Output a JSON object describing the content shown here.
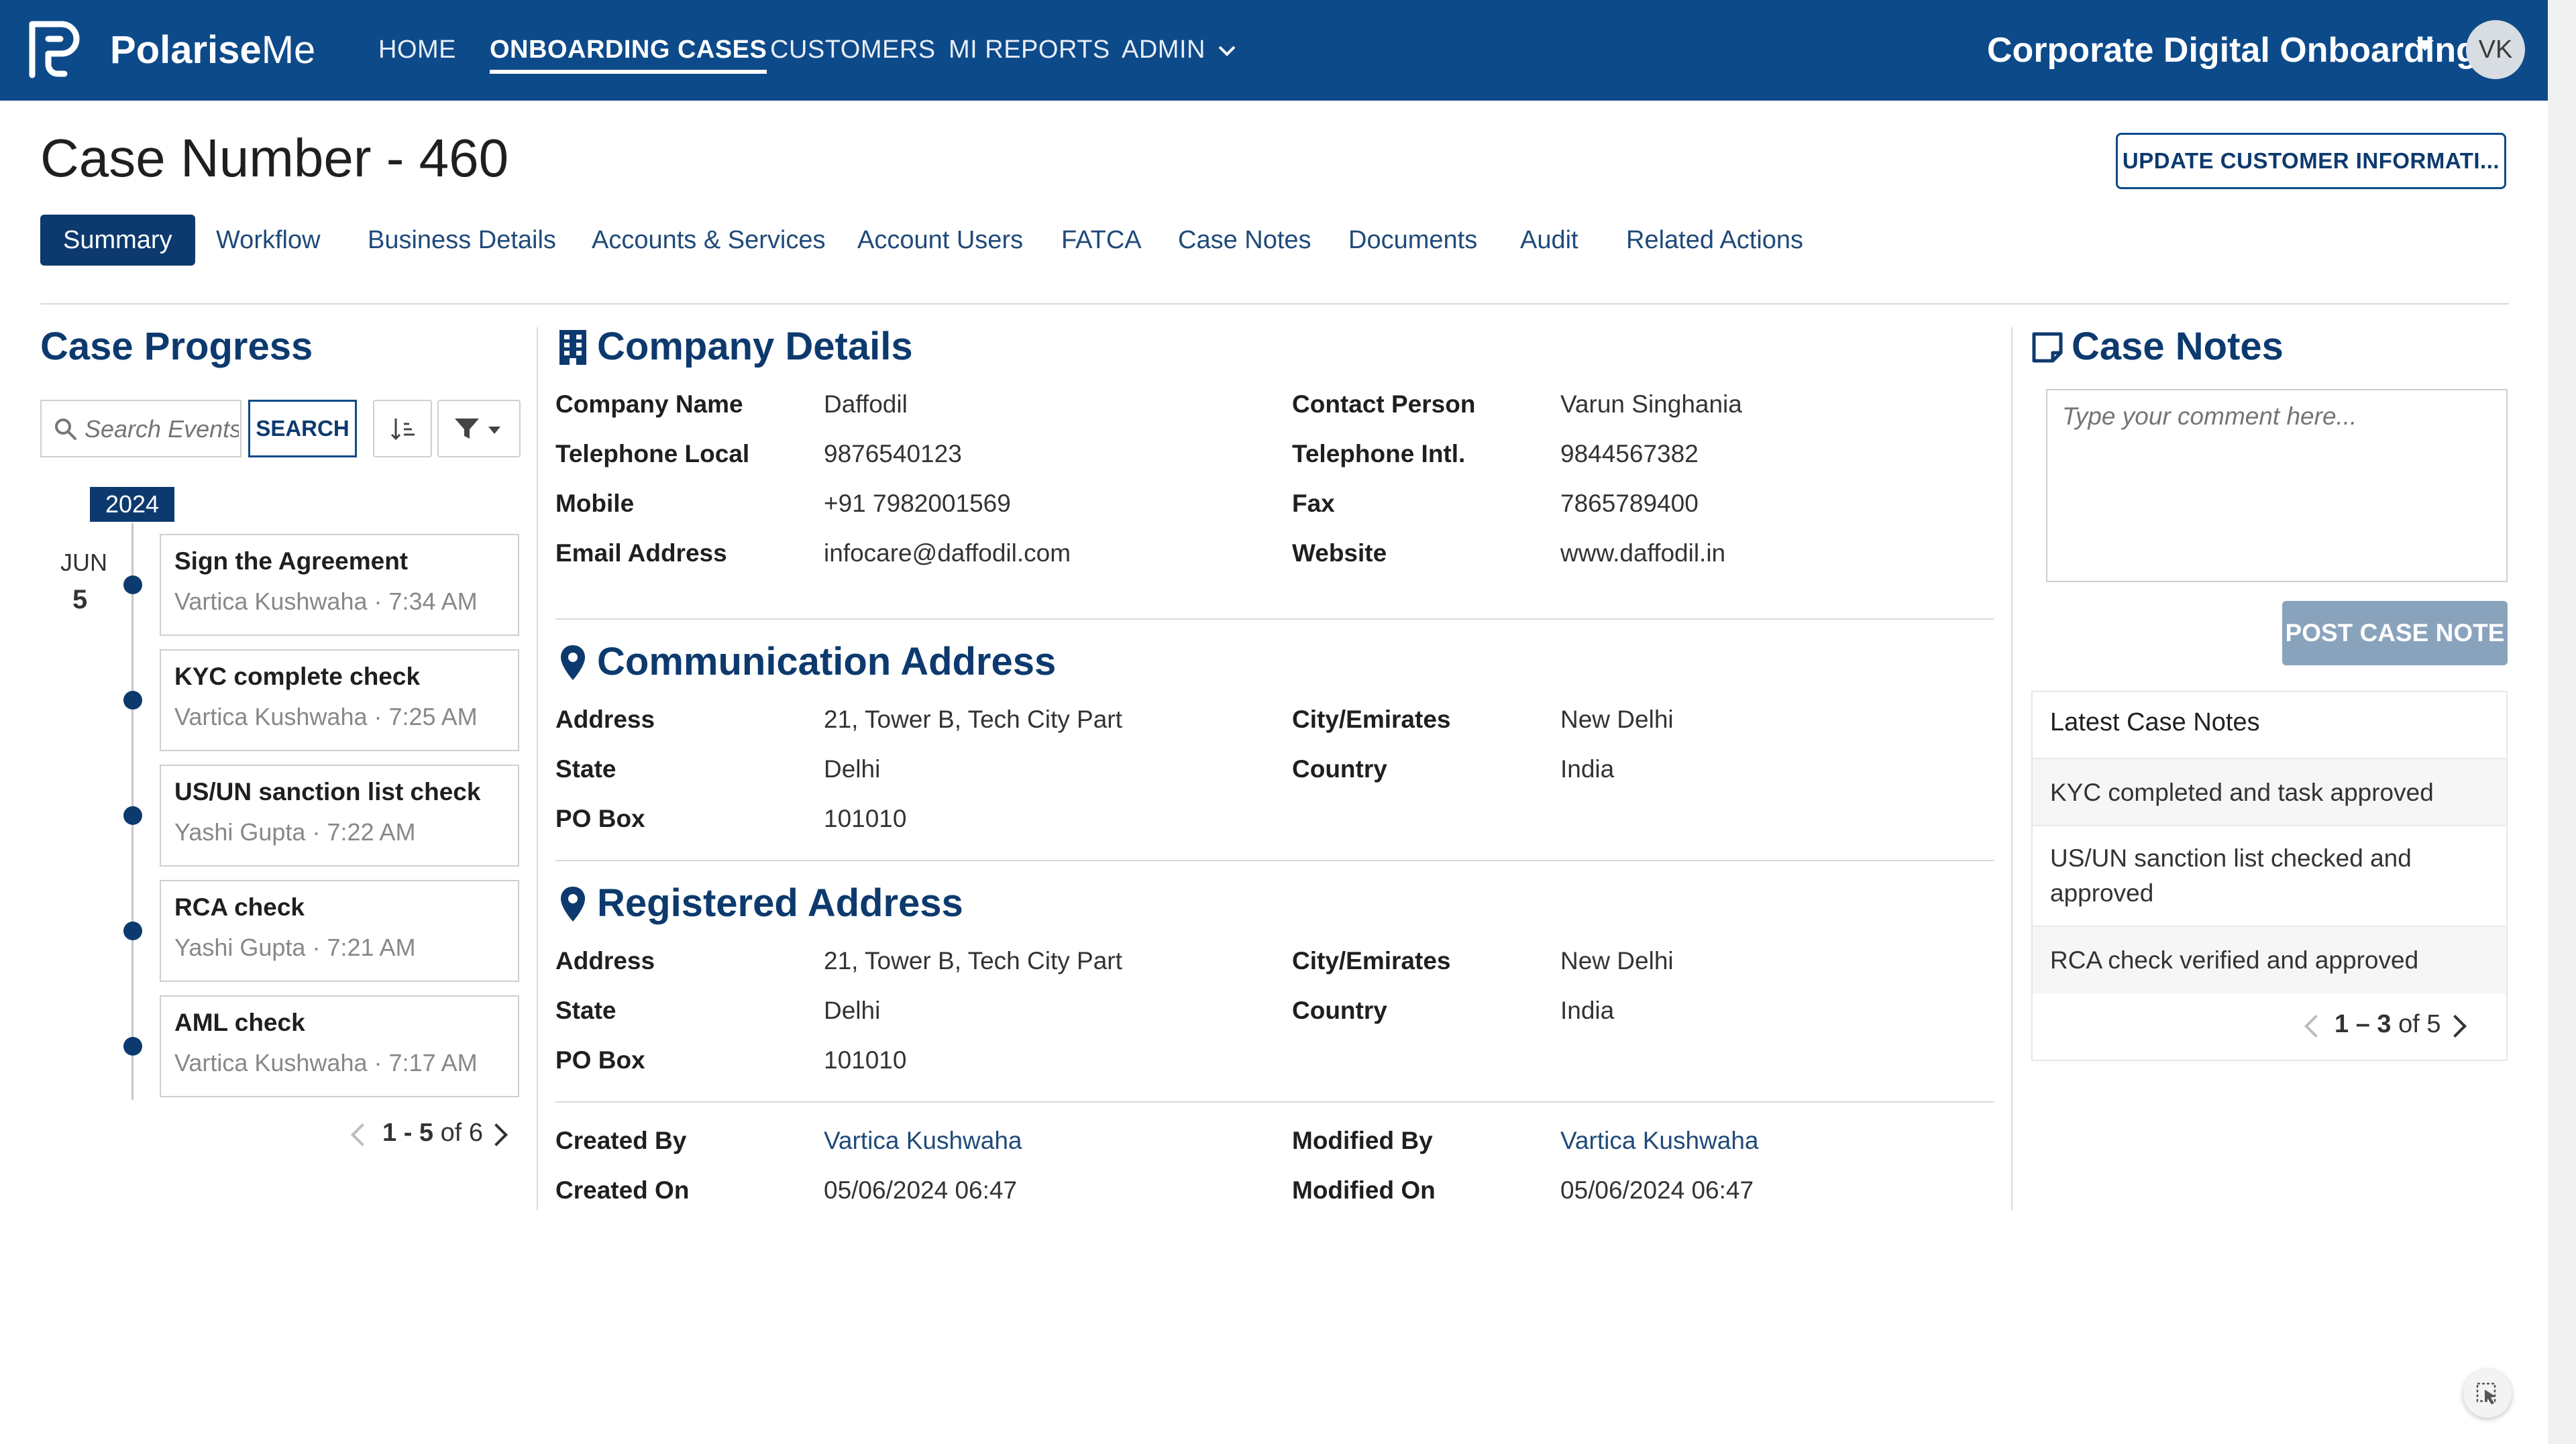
{
  "app": {
    "brand_prefix": "Polarise",
    "brand_suffix": "Me",
    "nav": [
      "HOME",
      "ONBOARDING CASES",
      "CUSTOMERS",
      "MI REPORTS",
      "ADMIN"
    ],
    "active_nav": "ONBOARDING CASES",
    "workspace": "Corporate Digital Onboarding",
    "user_initials": "VK",
    "accent_color": "#0d4a8a"
  },
  "header": {
    "title": "Case Number - 460",
    "update_button": "UPDATE CUSTOMER INFORMATI..."
  },
  "tabs": [
    "Summary",
    "Workflow",
    "Business Details",
    "Accounts & Services",
    "Account Users",
    "FATCA",
    "Case Notes",
    "Documents",
    "Audit",
    "Related Actions"
  ],
  "active_tab": "Summary",
  "progress": {
    "title": "Case Progress",
    "search_placeholder": "Search Events",
    "search_button": "SEARCH",
    "year": "2024",
    "month": "JUN",
    "day": "5",
    "events": [
      {
        "title": "Sign the Agreement",
        "meta": "Vartica Kushwaha · 7:34 AM"
      },
      {
        "title": "KYC complete check",
        "meta": "Vartica Kushwaha · 7:25 AM"
      },
      {
        "title": "US/UN sanction list check",
        "meta": "Yashi Gupta · 7:22 AM"
      },
      {
        "title": "RCA check",
        "meta": "Yashi Gupta · 7:21 AM"
      },
      {
        "title": "AML check",
        "meta": "Vartica Kushwaha · 7:17 AM"
      }
    ],
    "pager_range": "1 - 5",
    "pager_total": "of 6"
  },
  "company": {
    "title": "Company Details",
    "rows": [
      {
        "label": "Company Name",
        "value": "Daffodil",
        "label2": "Contact Person",
        "value2": "Varun Singhania"
      },
      {
        "label": "Telephone Local",
        "value": "9876540123",
        "label2": "Telephone Intl.",
        "value2": "9844567382"
      },
      {
        "label": "Mobile",
        "value": "+91 7982001569",
        "label2": "Fax",
        "value2": "7865789400"
      },
      {
        "label": "Email Address",
        "value": "infocare@daffodil.com",
        "label2": "Website",
        "value2": "www.daffodil.in"
      }
    ]
  },
  "communication": {
    "title": "Communication Address",
    "address_label": "Address",
    "address": "21, Tower B, Tech City Part",
    "city_label": "City/Emirates",
    "city": "New Delhi",
    "state_label": "State",
    "state": "Delhi",
    "country_label": "Country",
    "country": "India",
    "pobox_label": "PO Box",
    "pobox": "101010"
  },
  "registered": {
    "title": "Registered Address",
    "address_label": "Address",
    "address": "21, Tower B, Tech City Part",
    "city_label": "City/Emirates",
    "city": "New Delhi",
    "state_label": "State",
    "state": "Delhi",
    "country_label": "Country",
    "country": "India",
    "pobox_label": "PO Box",
    "pobox": "101010"
  },
  "audit": {
    "created_by_label": "Created By",
    "created_by": "Vartica Kushwaha",
    "modified_by_label": "Modified By",
    "modified_by": "Vartica Kushwaha",
    "created_on_label": "Created On",
    "created_on": "05/06/2024 06:47",
    "modified_on_label": "Modified On",
    "modified_on": "05/06/2024 06:47"
  },
  "notes": {
    "title": "Case Notes",
    "comment_placeholder": "Type your comment here...",
    "post_button": "POST CASE NOTE",
    "latest_title": "Latest Case Notes",
    "items": [
      "KYC completed and task approved",
      "US/UN sanction list checked and approved",
      "RCA check verified and approved"
    ],
    "pager_range": "1 – 3",
    "pager_total": "of 5"
  }
}
